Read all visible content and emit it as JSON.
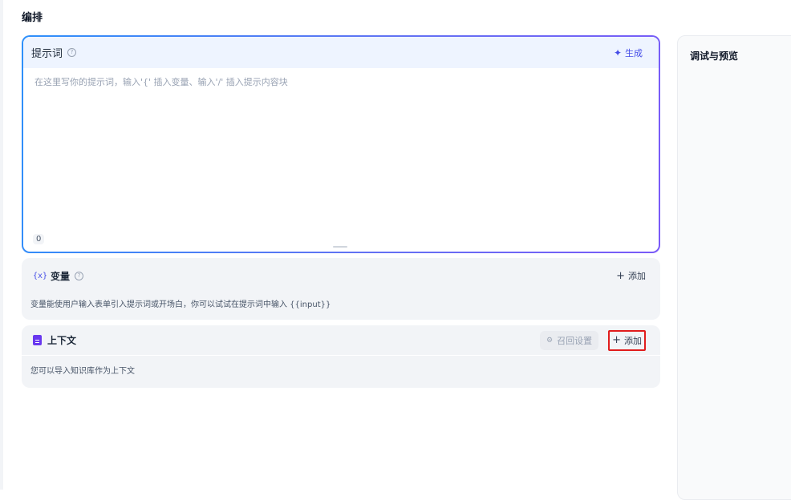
{
  "page": {
    "title": "编排"
  },
  "prompt": {
    "title": "提示词",
    "help": "?",
    "generate_label": "生成",
    "placeholder": "在这里写你的提示词，输入'{' 插入变量、输入'/' 插入提示内容块",
    "char_count": "0"
  },
  "variables": {
    "icon_text": "{x}",
    "title": "变量",
    "help": "?",
    "add_label": "添加",
    "description": "变量能使用户输入表单引入提示词或开场白，你可以试试在提示词中输入 {{input}}"
  },
  "context": {
    "title": "上下文",
    "recall_label": "召回设置",
    "add_label": "添加",
    "description": "您可以导入知识库作为上下文"
  },
  "preview": {
    "title": "调试与预览"
  },
  "colors": {
    "accent": "#444ce7",
    "highlight": "#e11d1d",
    "context_icon": "#6938ef"
  }
}
